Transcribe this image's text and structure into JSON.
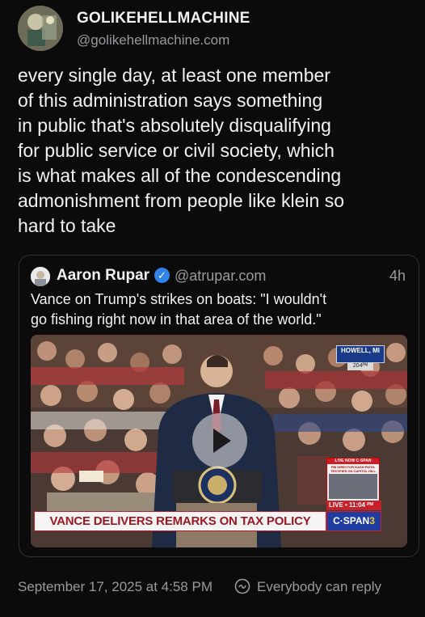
{
  "post": {
    "author_name": "GOLIKEHELLMACHINE",
    "author_handle": "@golikehellmachine.com",
    "text_lines": [
      "every single day, at least one member",
      "of this administration says something",
      "in public that's absolutely disqualifying",
      "for public service or civil society, which",
      "is what makes all of the condescending",
      "admonishment from people like klein so",
      "hard to take"
    ],
    "timestamp": "September 17, 2025 at 4:58 PM",
    "reply_setting": "Everybody can reply"
  },
  "quote": {
    "author_name": "Aaron Rupar",
    "author_handle": "@atrupar.com",
    "time_ago": "4h",
    "verified_glyph": "✓",
    "text_lines": [
      "Vance on Trump's strikes on boats: \"I wouldn't",
      "go fishing right now in that area of the world.\""
    ],
    "video": {
      "location": "HOWELL, MI",
      "temperature": "204ᴾᴹ",
      "banner": "VANCE DELIVERS REMARKS ON TAX POLICY",
      "network": "C·SPAN",
      "network_suffix": "3",
      "live_label": "LIVE • 11:04 ᴾᴹ",
      "inset_header": "LIVE NOW C·SPAN",
      "inset_caption": "FBI DIRECTOR KASH PATEL TESTIFIES ON CAPITOL HILL",
      "play_icon": "play-icon"
    }
  },
  "colors": {
    "background": "#0b0b0c",
    "text": "#f2f2f2",
    "muted": "#9a9a9e",
    "verified": "#2f83ea",
    "banner_red": "#9d1721",
    "cspan_blue": "#1f3da0"
  }
}
